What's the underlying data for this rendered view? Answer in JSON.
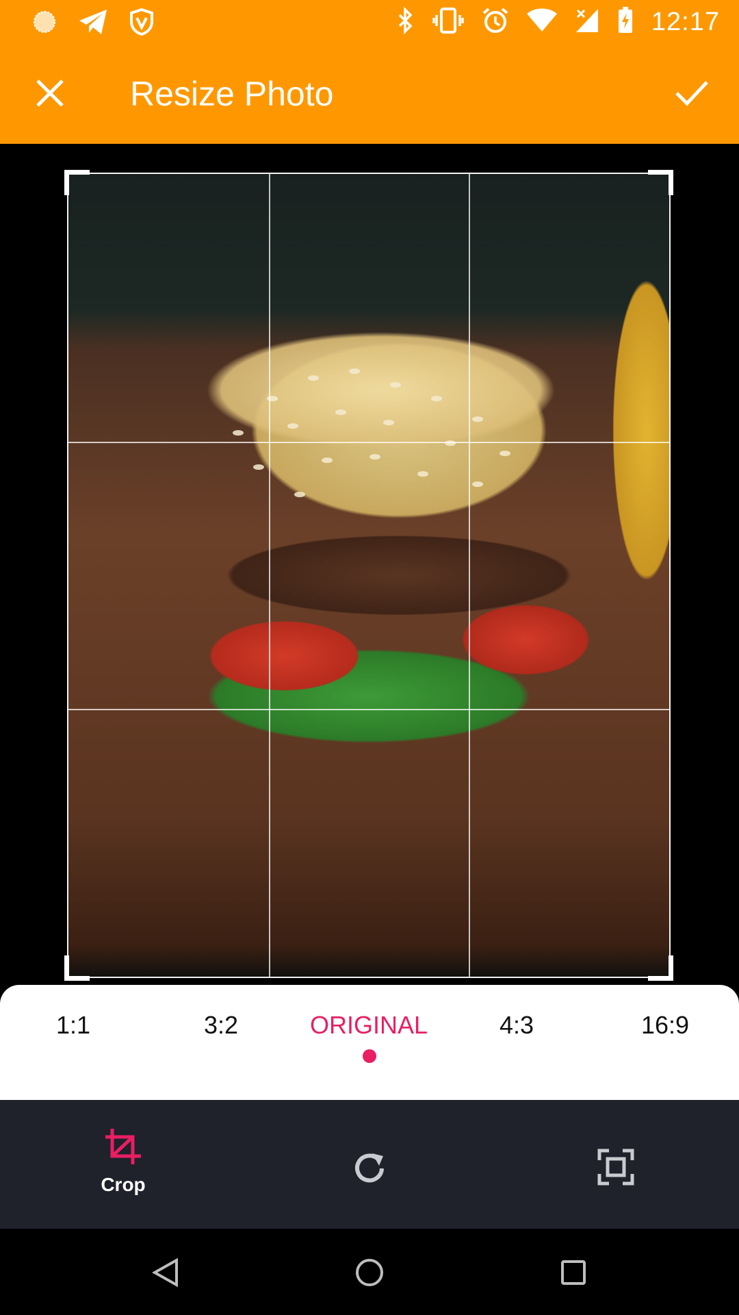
{
  "status_bar": {
    "time": "12:17",
    "left_icons": [
      "sun-icon",
      "telegram-icon",
      "shield-icon"
    ],
    "right_icons": [
      "bluetooth-icon",
      "vibrate-icon",
      "alarm-icon",
      "wifi-icon",
      "signal-icon",
      "battery-icon"
    ]
  },
  "app_bar": {
    "title": "Resize Photo",
    "close_icon": "close-icon",
    "confirm_icon": "check-icon",
    "background_color": "#FF9800"
  },
  "editor": {
    "grid": "rule-of-thirds",
    "image": "burger-photo"
  },
  "aspect_ratios": {
    "options": [
      "1:1",
      "3:2",
      "ORIGINAL",
      "4:3",
      "16:9"
    ],
    "selected": "ORIGINAL",
    "accent_color": "#E91E63"
  },
  "tools": {
    "crop_label": "Crop",
    "items": [
      "crop-icon",
      "rotate-icon",
      "fit-screen-icon"
    ],
    "active": "Crop"
  },
  "nav_bar": [
    "back-icon",
    "home-icon",
    "recents-icon"
  ]
}
